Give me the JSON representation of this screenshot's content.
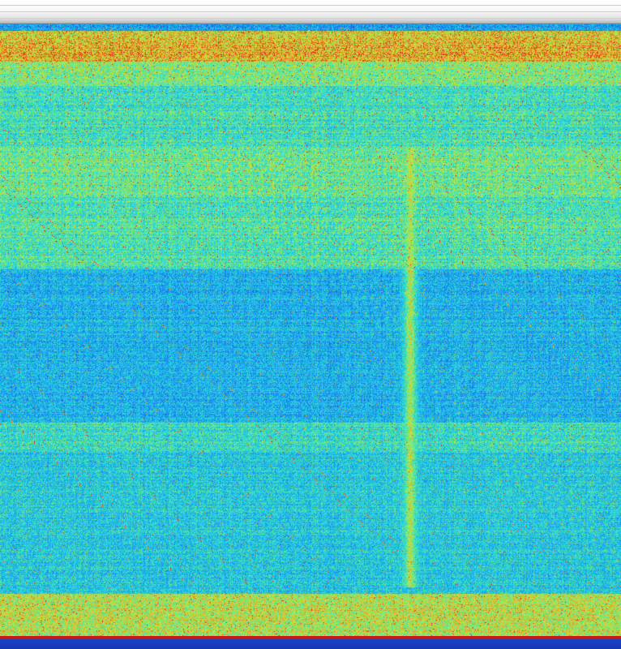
{
  "chart_data": {
    "type": "heatmap",
    "title": "",
    "xlabel": "",
    "ylabel": "",
    "colormap": [
      "#1a3cc8",
      "#1f6fe6",
      "#1aa6f0",
      "#22d4e0",
      "#5fe890",
      "#c8e83c",
      "#e8a020",
      "#d82020"
    ],
    "band_profile": [
      {
        "row_start": 0.0,
        "row_end": 0.01,
        "level": 0.25
      },
      {
        "row_start": 0.01,
        "row_end": 0.06,
        "level": 0.8
      },
      {
        "row_start": 0.06,
        "row_end": 0.1,
        "level": 0.62
      },
      {
        "row_start": 0.1,
        "row_end": 0.2,
        "level": 0.5
      },
      {
        "row_start": 0.2,
        "row_end": 0.28,
        "level": 0.58
      },
      {
        "row_start": 0.28,
        "row_end": 0.4,
        "level": 0.52
      },
      {
        "row_start": 0.4,
        "row_end": 0.65,
        "level": 0.33
      },
      {
        "row_start": 0.65,
        "row_end": 0.7,
        "level": 0.48
      },
      {
        "row_start": 0.7,
        "row_end": 0.93,
        "level": 0.4
      },
      {
        "row_start": 0.93,
        "row_end": 1.0,
        "level": 0.7
      }
    ],
    "vertical_feature": {
      "col": 0.66,
      "col_width": 0.025,
      "row_start": 0.2,
      "row_end": 0.92,
      "level": 0.72
    },
    "grid": false,
    "legend": "none"
  }
}
